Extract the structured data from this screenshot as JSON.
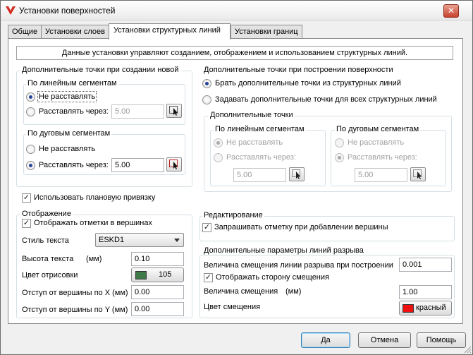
{
  "window": {
    "title": "Установки поверхностей"
  },
  "tabs": [
    "Общие",
    "Установки слоев",
    "Установки структурных линий",
    "Установки границ"
  ],
  "info_text": "Данные установки управляют созданием, отображением и использованием структурных линий.",
  "left_points": {
    "title": "Дополнительные точки при создании новой",
    "linear": {
      "title": "По линейным сегментам",
      "option_none": "Не расставлять",
      "option_every": "Расставлять через:",
      "value": "5.00"
    },
    "arc": {
      "title": "По дуговым сегментам",
      "option_none": "Не расставлять",
      "option_every": "Расставлять через:",
      "value": "5.00"
    }
  },
  "right_points": {
    "title": "Дополнительные точки при построении поверхности",
    "option_take": "Брать дополнительные точки из структурных линий",
    "option_set": "Задавать дополнительные точки для всех структурных линий",
    "sub_title": "Дополнительные точки",
    "linear": {
      "title": "По линейным сегментам",
      "option_none": "Не расставлять",
      "option_every": "Расставлять через:",
      "value": "5.00"
    },
    "arc": {
      "title": "По дуговым сегментам",
      "option_none": "Не расставлять",
      "option_every": "Расставлять через:",
      "value": "5.00"
    }
  },
  "plan_snap_label": "Использовать плановую привязку",
  "display": {
    "title": "Отображение",
    "show_marks": "Отображать отметки в вершинах",
    "text_style_label": "Стиль текста",
    "text_style_value": "ESKD1",
    "text_height_label": "Высота текста",
    "text_height_unit": "(мм)",
    "text_height_value": "0.10",
    "draw_color_label": "Цвет отрисовки",
    "draw_color_value": "105",
    "draw_color_hex": "#3f7a48",
    "offset_x_label": "Отступ от вершины по X (мм)",
    "offset_x_value": "0.00",
    "offset_y_label": "Отступ от вершины по Y (мм)",
    "offset_y_value": "0.00"
  },
  "editing": {
    "title": "Редактирование",
    "ask_mark": "Запрашивать отметку при добавлении вершины"
  },
  "break_lines": {
    "title": "Дополнительные параметры линий разрыва",
    "offset_build_label": "Величина смещения линии разрыва при построении",
    "offset_build_value": "0.001",
    "show_side": "Отображать сторону смещения",
    "offset_label": "Величина смещения",
    "offset_unit": "(мм)",
    "offset_value": "1.00",
    "color_label": "Цвет смещения",
    "color_value": "красный",
    "color_hex": "#ee1111"
  },
  "buttons": {
    "ok": "Да",
    "cancel": "Отмена",
    "help": "Помощь"
  }
}
